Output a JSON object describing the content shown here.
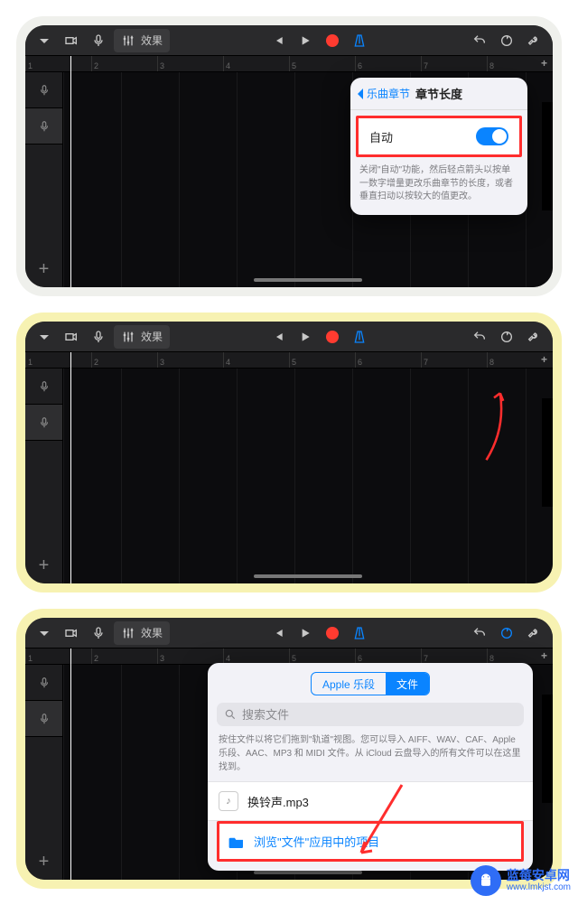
{
  "toolbar": {
    "fx_label": "效果",
    "ruler_end": "+"
  },
  "step1": {
    "popover": {
      "back_label": "乐曲章节",
      "title": "章节长度",
      "auto_label": "自动",
      "note_text": "关闭\"自动\"功能，然后轻点箭头以按单一数字增量更改乐曲章节的长度，或者垂直扫动以按较大的值更改。"
    }
  },
  "step3": {
    "seg": {
      "loops": "Apple 乐段",
      "files": "文件"
    },
    "search_placeholder": "搜索文件",
    "hint_text": "按住文件以将它们拖到\"轨道\"视图。您可以导入 AIFF、WAV、CAF、Apple 乐段、AAC、MP3 和 MIDI 文件。从 iCloud 云盘导入的所有文件可以在这里找到。",
    "file_name": "换铃声.mp3",
    "browse_label": "浏览\"文件\"应用中的项目"
  },
  "ticks": [
    "1",
    "2",
    "3",
    "4",
    "5",
    "6",
    "7",
    "8"
  ],
  "watermark": {
    "name": "蓝莓安卓网",
    "url": "www.lmkjst.com"
  }
}
